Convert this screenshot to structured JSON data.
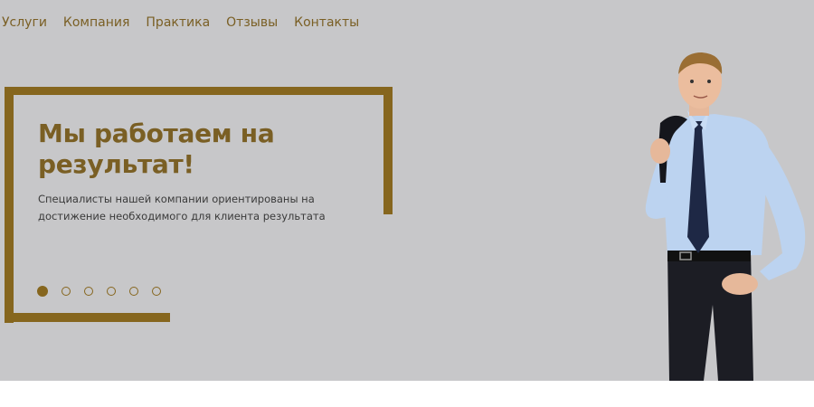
{
  "nav": {
    "items": [
      "Услуги",
      "Компания",
      "Практика",
      "Отзывы",
      "Контакты"
    ]
  },
  "hero": {
    "title": "Мы работаем на результат!",
    "description": "Специалисты нашей компании ориентированы на достижение необходимого для клиента результата"
  },
  "slider": {
    "count": 6,
    "active_index": 0
  },
  "colors": {
    "accent": "#86661e",
    "background": "#c7c7c9"
  }
}
